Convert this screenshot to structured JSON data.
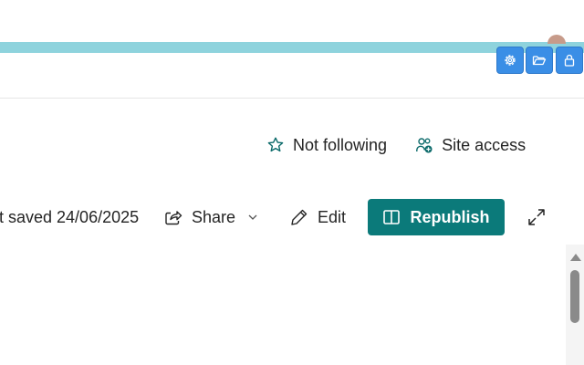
{
  "header": {
    "tools": [
      {
        "icon": "gear-icon"
      },
      {
        "icon": "folder-open-icon"
      },
      {
        "icon": "lock-icon"
      }
    ]
  },
  "follow_bar": {
    "follow_label": "Not following",
    "follow_icon": "star-icon",
    "site_access_label": "Site access",
    "site_access_icon": "people-add-icon"
  },
  "command_bar": {
    "draft_status": "ft saved 24/06/2025",
    "share_label": "Share",
    "share_icon": "share-icon",
    "edit_label": "Edit",
    "edit_icon": "pencil-icon",
    "republish_label": "Republish",
    "republish_icon": "book-open-icon",
    "expand_icon": "expand-icon"
  },
  "colors": {
    "accent_strip": "#8ed3dd",
    "tool_button": "#3a8ee6",
    "primary_button": "#0b7a7a",
    "icon_teal": "#0b6a6a"
  }
}
